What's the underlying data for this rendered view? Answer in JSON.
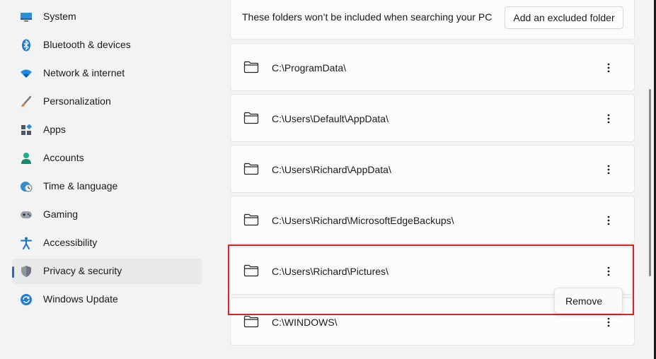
{
  "sidebar": {
    "items": [
      {
        "label": "System",
        "icon": "system-icon"
      },
      {
        "label": "Bluetooth & devices",
        "icon": "bluetooth-icon"
      },
      {
        "label": "Network & internet",
        "icon": "wifi-icon"
      },
      {
        "label": "Personalization",
        "icon": "brush-icon"
      },
      {
        "label": "Apps",
        "icon": "apps-icon"
      },
      {
        "label": "Accounts",
        "icon": "person-icon"
      },
      {
        "label": "Time & language",
        "icon": "globe-clock-icon"
      },
      {
        "label": "Gaming",
        "icon": "gamepad-icon"
      },
      {
        "label": "Accessibility",
        "icon": "accessibility-icon"
      },
      {
        "label": "Privacy & security",
        "icon": "shield-icon",
        "selected": true
      },
      {
        "label": "Windows Update",
        "icon": "update-icon"
      }
    ]
  },
  "excluded": {
    "description": "These folders won’t be included when searching your PC",
    "add_button": "Add an excluded folder",
    "folders": [
      "C:\\ProgramData\\",
      "C:\\Users\\Default\\AppData\\",
      "C:\\Users\\Richard\\AppData\\",
      "C:\\Users\\Richard\\MicrosoftEdgeBackups\\",
      "C:\\Users\\Richard\\Pictures\\",
      "C:\\WINDOWS\\"
    ]
  },
  "context_menu": {
    "remove_label": "Remove"
  },
  "colors": {
    "accent": "#1f6bc7",
    "highlight": "#d6232c"
  }
}
